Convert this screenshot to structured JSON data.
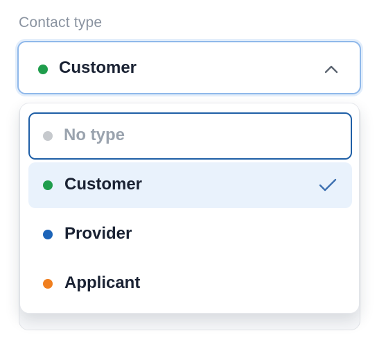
{
  "field": {
    "label": "Contact type",
    "selected_value": "Customer",
    "selected_color": "#1f9d4c"
  },
  "menu": {
    "search": {
      "placeholder": "No type",
      "value": "",
      "color": "#c6c9cd"
    },
    "options": [
      {
        "label": "Customer",
        "color": "#1f9d4c",
        "selected": true
      },
      {
        "label": "Provider",
        "color": "#1c64b8",
        "selected": false
      },
      {
        "label": "Applicant",
        "color": "#f07f1f",
        "selected": false
      }
    ]
  },
  "icons": {
    "trigger_chevron": "chevron-up-icon",
    "selected_mark": "checkmark-icon"
  },
  "colors": {
    "accent": "#1f5fa6",
    "selected_bg": "#e9f2fc",
    "check": "#3c6fb0"
  }
}
